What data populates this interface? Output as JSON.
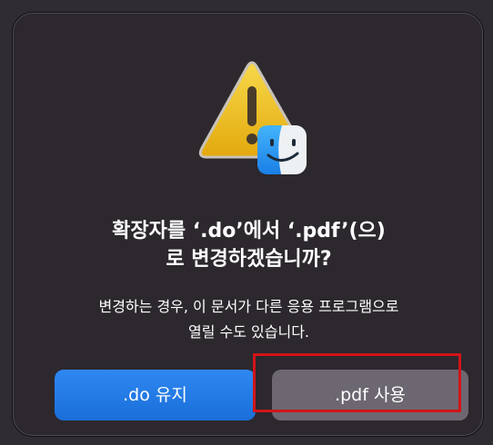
{
  "dialog": {
    "title_line1": "확장자를 ‘.do’에서 ‘.pdf’(으)",
    "title_line2": "로 변경하겠습니까?",
    "message_line1": "변경하는 경우, 이 문서가 다른 응용 프로그램으로",
    "message_line2": "열릴 수도 있습니다.",
    "icon": "warning-triangle-with-finder-badge-icon",
    "buttons": {
      "keep_label": ".do 유지",
      "use_label": ".pdf 사용"
    }
  },
  "colors": {
    "dialog_background": "#2c282e",
    "primary_button": "#1a6fd9",
    "secondary_button": "#6c6770",
    "highlight": "#d21419",
    "warning_yellow": "#f2c31a"
  }
}
